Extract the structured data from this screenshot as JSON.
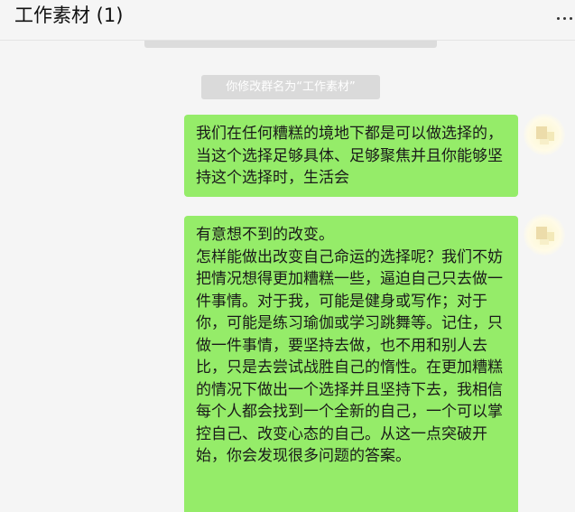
{
  "header": {
    "title": "工作素材 (1)"
  },
  "chat": {
    "system_notice": "你修改群名为“工作素材”",
    "messages": [
      {
        "lines": [
          "我们在任何糟糕的境地下都是可以做选择的，当这个选择足够具体、足够聚焦并且你能够坚持这个选择时，生活会"
        ]
      },
      {
        "lines": [
          "有意想不到的改变。",
          "怎样能做出改变自己命运的选择呢？我们不妨把情况想得更加糟糕一些，逼迫自己只去做一件事情。对于我，可能是健身或写作；对于你，可能是练习瑜伽或学习跳舞等。记住，只做一件事情，要坚持去做，也不用和别人去比，只是去尝试战胜自己的惰性。在更加糟糕的情况下做出一个选择并且坚持下去，我相信每个人都会找到一个全新的自己，一个可以掌控自己、改变心态的自己。从这一点突破开始，你会发现很多问题的答案。"
        ]
      }
    ]
  },
  "colors": {
    "bubble_self": "#95ec69",
    "background": "#f5f5f5",
    "system_notice_bg": "#dadada"
  },
  "icons": {
    "more": "more-dots-icon",
    "avatar": "avatar-image"
  }
}
